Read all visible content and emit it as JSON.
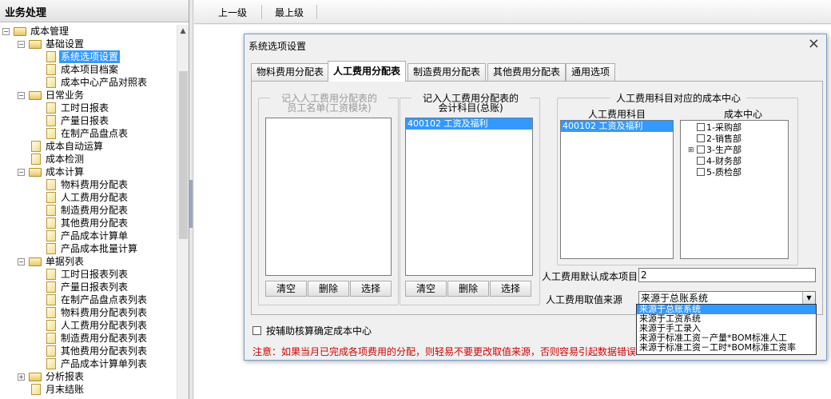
{
  "sidebar": {
    "title": "业务处理",
    "tree": [
      {
        "label": "成本管理",
        "level": 0,
        "type": "folder",
        "expanded": true
      },
      {
        "label": "基础设置",
        "level": 1,
        "type": "folder",
        "expanded": true
      },
      {
        "label": "系统选项设置",
        "level": 2,
        "type": "doc",
        "selected": true
      },
      {
        "label": "成本项目档案",
        "level": 2,
        "type": "doc"
      },
      {
        "label": "成本中心产品对照表",
        "level": 2,
        "type": "doc"
      },
      {
        "label": "日常业务",
        "level": 1,
        "type": "folder",
        "expanded": true
      },
      {
        "label": "工时日报表",
        "level": 2,
        "type": "doc"
      },
      {
        "label": "产量日报表",
        "level": 2,
        "type": "doc"
      },
      {
        "label": "在制产品盘点表",
        "level": 2,
        "type": "doc"
      },
      {
        "label": "成本自动运算",
        "level": 1,
        "type": "doc"
      },
      {
        "label": "成本检测",
        "level": 1,
        "type": "doc"
      },
      {
        "label": "成本计算",
        "level": 1,
        "type": "folder",
        "expanded": true
      },
      {
        "label": "物料费用分配表",
        "level": 2,
        "type": "doc"
      },
      {
        "label": "人工费用分配表",
        "level": 2,
        "type": "doc"
      },
      {
        "label": "制造费用分配表",
        "level": 2,
        "type": "doc"
      },
      {
        "label": "其他费用分配表",
        "level": 2,
        "type": "doc"
      },
      {
        "label": "产品成本计算单",
        "level": 2,
        "type": "doc"
      },
      {
        "label": "产品成本批量计算",
        "level": 2,
        "type": "doc"
      },
      {
        "label": "单据列表",
        "level": 1,
        "type": "folder",
        "expanded": true
      },
      {
        "label": "工时日报表列表",
        "level": 2,
        "type": "doc"
      },
      {
        "label": "产量日报表列表",
        "level": 2,
        "type": "doc"
      },
      {
        "label": "在制产品盘点表列表",
        "level": 2,
        "type": "doc"
      },
      {
        "label": "物料费用分配表列表",
        "level": 2,
        "type": "doc"
      },
      {
        "label": "人工费用分配表列表",
        "level": 2,
        "type": "doc"
      },
      {
        "label": "制造费用分配表列表",
        "level": 2,
        "type": "doc"
      },
      {
        "label": "其他费用分配表列表",
        "level": 2,
        "type": "doc"
      },
      {
        "label": "产品成本计算单列表",
        "level": 2,
        "type": "doc"
      },
      {
        "label": "分析报表",
        "level": 1,
        "type": "folder",
        "expanded": false
      },
      {
        "label": "月末结账",
        "level": 1,
        "type": "doc"
      }
    ]
  },
  "toolbar": {
    "up_level": "上一级",
    "top_level": "最上级"
  },
  "dialog": {
    "title": "系统选项设置",
    "tabs": [
      "物料费用分配表",
      "人工费用分配表",
      "制造费用分配表",
      "其他费用分配表",
      "通用选项"
    ],
    "active_tab": 1,
    "group1": {
      "title_line1": "记入人工费用分配表的",
      "title_line2": "员工名单(工资模块)",
      "items": []
    },
    "group2": {
      "title_line1": "记入人工费用分配表的",
      "title_line2": "会计科目(总账)",
      "items": [
        "400102  工资及福利"
      ]
    },
    "buttons": {
      "clear": "清空",
      "delete": "删除",
      "select": "选择"
    },
    "group3": {
      "title": "人工费用科目对应的成本中心",
      "col1_header": "人工费用科目",
      "col2_header": "成本中心",
      "accounts": [
        "400102  工资及福利"
      ],
      "cost_centers": [
        "1-采购部",
        "2-销售部",
        "3-生产部",
        "4-财务部",
        "5-质检部"
      ]
    },
    "default_cost_item_label": "人工费用默认成本项目",
    "default_cost_item_value": "2",
    "value_source_label": "人工费用取值来源",
    "value_source_selected": "来源于总账系统",
    "value_source_options": [
      "来源于总账系统",
      "来源于工资系统",
      "来源于手工录入",
      "来源于标准工资－产量*BOM标准人工",
      "来源于标准工资－工时*BOM标准工资率"
    ],
    "aux_check_label": "按辅助核算确定成本中心",
    "warning": "注意：如果当月已完成各项费用的分配，则轻易不要更改取值来源，否则容易引起数据错误！"
  }
}
